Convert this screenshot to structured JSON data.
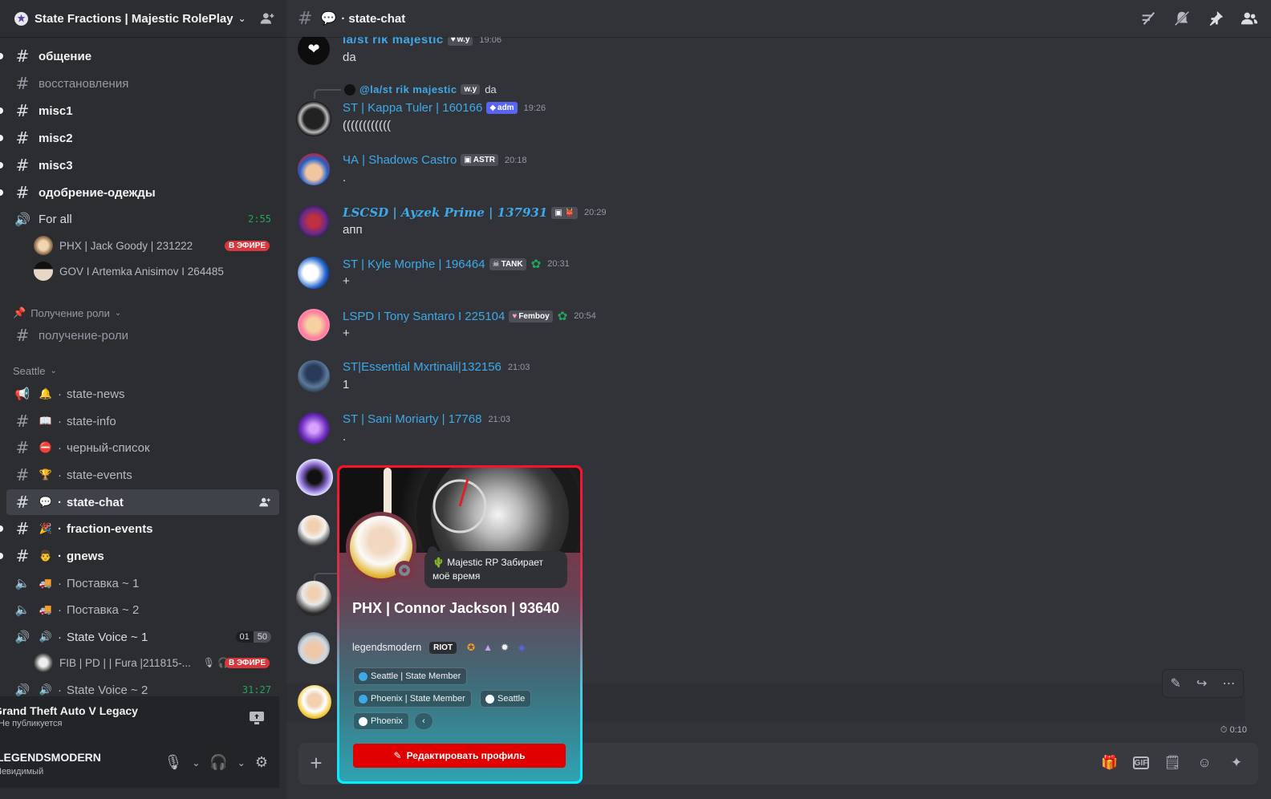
{
  "server": {
    "name": "State Fractions | Majestic RolePlay"
  },
  "channels": [
    {
      "name": "общение",
      "type": "text",
      "state": "unread"
    },
    {
      "name": "восстановления",
      "type": "text",
      "state": "read"
    },
    {
      "name": "misc1",
      "type": "text",
      "state": "unread"
    },
    {
      "name": "misc2",
      "type": "text",
      "state": "unread"
    },
    {
      "name": "misc3",
      "type": "text",
      "state": "unread"
    },
    {
      "name": "одобрение-одежды",
      "type": "text",
      "state": "unread"
    },
    {
      "name": "For all",
      "type": "voice",
      "state": "read",
      "timer": "2:55"
    }
  ],
  "voice_users_for_all": [
    {
      "name": "PHX | Jack Goody | 231222",
      "live": "В ЭФИРЕ"
    },
    {
      "name": "GOV I Artemka Anisimov I 264485",
      "live": ""
    }
  ],
  "category_roles": {
    "name": "Получение роли"
  },
  "roles_channel": {
    "name": "получение-роли"
  },
  "category_seattle": {
    "name": "Seattle"
  },
  "seattle_channels": [
    {
      "name": "state-news",
      "emoji": "🔔",
      "state": "read"
    },
    {
      "name": "state-info",
      "emoji": "📖",
      "state": "read"
    },
    {
      "name": "черный-список",
      "emoji": "⛔",
      "state": "read"
    },
    {
      "name": "state-events",
      "emoji": "🏆",
      "state": "read"
    },
    {
      "name": "state-chat",
      "emoji": "💬",
      "state": "selected"
    },
    {
      "name": "fraction-events",
      "emoji": "🎉",
      "state": "unread"
    },
    {
      "name": "gnews",
      "emoji": "👨",
      "state": "unread"
    },
    {
      "name": "Поставка ~ 1",
      "emoji": "🚚",
      "state": "read"
    },
    {
      "name": "Поставка ~ 2",
      "emoji": "🚚",
      "state": "read"
    },
    {
      "name": "State Voice ~ 1",
      "emoji": "🔊",
      "state": "read",
      "count_left": "01",
      "count_right": "50"
    }
  ],
  "voice_users_state1": [
    {
      "name": "FIB | PD | | Fura |211815-...",
      "live": "В ЭФИРЕ"
    }
  ],
  "cut_channel": {
    "name": "State Voice ~ 2",
    "timer": "31:27"
  },
  "activity": {
    "title": "Grand Theft Auto V Legacy",
    "subtitle": "Не публикуется"
  },
  "user": {
    "name": "LEGENDSMODERN",
    "status": "Невидимый"
  },
  "topbar": {
    "channel": "state-chat",
    "dot": "·"
  },
  "messages": [
    {
      "name": "la/st rik majestic",
      "tag": "w.y",
      "time": "19:06",
      "text": "da"
    },
    {
      "name": "ST | Kappa Tuler | 160166",
      "tag": "adm",
      "time": "19:26",
      "text": "((((((((((((",
      "reply_name": "@la/st rik majestic",
      "reply_tag": "w.y",
      "reply_text": "da"
    },
    {
      "name": "ЧА | Shadows Castro",
      "tag": "ASTR",
      "time": "20:18",
      "text": "."
    },
    {
      "name": "LSCSD | Ayzek Prime | 137931",
      "tag": "",
      "time": "20:29",
      "text": "апп"
    },
    {
      "name": "ST | Kyle Morphe | 196464",
      "tag": "TANK",
      "time": "20:31",
      "text": "+"
    },
    {
      "name": "LSPD I Tony Santaro I 225104",
      "tag": "Femboy",
      "time": "20:54",
      "text": "+"
    },
    {
      "name": "ST|Essential Mxrtinali|132156",
      "tag": "",
      "time": "21:03",
      "text": "1"
    },
    {
      "name": "ST | Sani Moriarty | 17768",
      "tag": "",
      "time": "21:03",
      "text": "."
    }
  ],
  "composer": {
    "timer": "0:10"
  },
  "profile": {
    "display_name": "PHX | Connor Jackson | 93640",
    "username": "legendsmodern",
    "game_badge": "RIOT",
    "status_text": "Majestic RP Забирает моё время",
    "roles": [
      {
        "name": "Seattle | State Member",
        "color": "#3fa9e8"
      },
      {
        "name": "Phoenix | State Member",
        "color": "#3fa9e8"
      },
      {
        "name": "Seattle",
        "color": "#ffffff"
      },
      {
        "name": "Phoenix",
        "color": "#ffffff"
      }
    ],
    "edit_button": "Редактировать профиль"
  }
}
